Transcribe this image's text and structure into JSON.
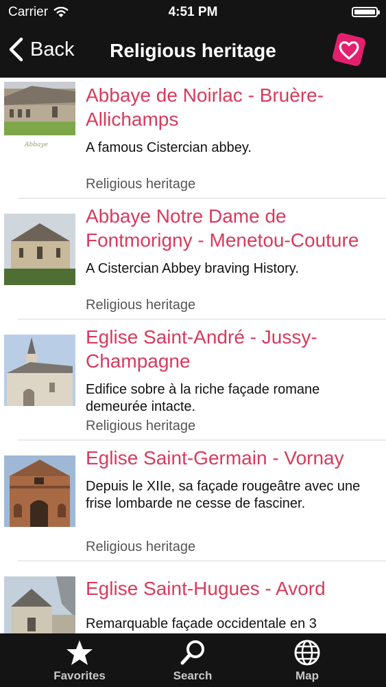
{
  "status_bar": {
    "carrier": "Carrier",
    "time": "4:51 PM"
  },
  "nav": {
    "back_label": "Back",
    "title": "Religious heritage"
  },
  "items": [
    {
      "title": "Abbaye de Noirlac - Bruère-Allichamps",
      "description": "A famous Cistercian abbey.",
      "category": "Religious heritage"
    },
    {
      "title": "Abbaye Notre Dame de Fontmorigny  - Menetou-Couture",
      "description": "A Cistercian Abbey braving History.",
      "category": "Religious heritage"
    },
    {
      "title": "Eglise Saint-André - Jussy-Champagne",
      "description": "Edifice sobre à la riche façade romane demeurée intacte.",
      "category": "Religious heritage"
    },
    {
      "title": "Eglise Saint-Germain - Vornay",
      "description": "Depuis le XIIe, sa façade rougeâtre avec une frise lombarde ne cesse de fasciner.",
      "category": "Religious heritage"
    },
    {
      "title": "Eglise Saint-Hugues - Avord",
      "description": "Remarquable façade occidentale en 3",
      "category": ""
    }
  ],
  "tabs": [
    {
      "label": "Favorites",
      "icon": "star-icon"
    },
    {
      "label": "Search",
      "icon": "search-icon"
    },
    {
      "label": "Map",
      "icon": "globe-icon"
    }
  ],
  "colors": {
    "accent": "#d83a5c",
    "bar": "#141414",
    "brand": "#e4206e"
  }
}
